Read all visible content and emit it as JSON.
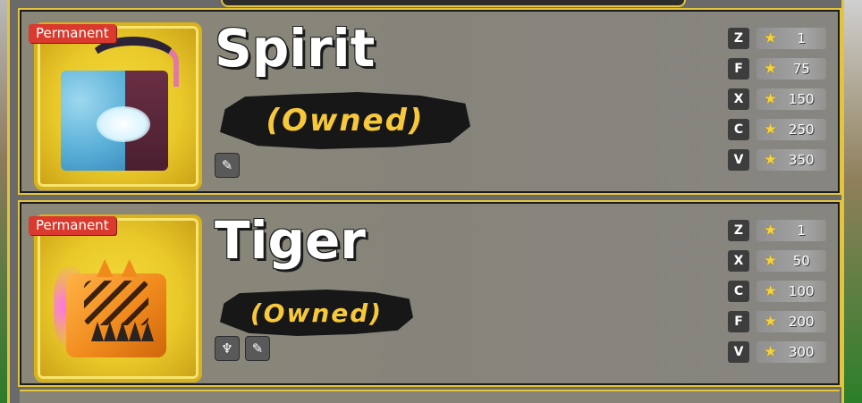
{
  "fruits": [
    {
      "tag": "Permanent",
      "name": "Spirit",
      "status": "(Owned)",
      "abilities": [
        "✎"
      ],
      "moves": [
        {
          "key": "Z",
          "level": "1"
        },
        {
          "key": "F",
          "level": "75"
        },
        {
          "key": "X",
          "level": "150"
        },
        {
          "key": "C",
          "level": "250"
        },
        {
          "key": "V",
          "level": "350"
        }
      ]
    },
    {
      "tag": "Permanent",
      "name": "Tiger",
      "status": "(Owned)",
      "abilities": [
        "♆",
        "✎"
      ],
      "moves": [
        {
          "key": "Z",
          "level": "1"
        },
        {
          "key": "X",
          "level": "50"
        },
        {
          "key": "C",
          "level": "100"
        },
        {
          "key": "F",
          "level": "200"
        },
        {
          "key": "V",
          "level": "300"
        }
      ]
    }
  ],
  "icons": {
    "star": "★"
  },
  "colors": {
    "frame_gold": "#e4c43a",
    "tag_red": "#d93a2d",
    "owned_yellow": "#f6c83a"
  }
}
